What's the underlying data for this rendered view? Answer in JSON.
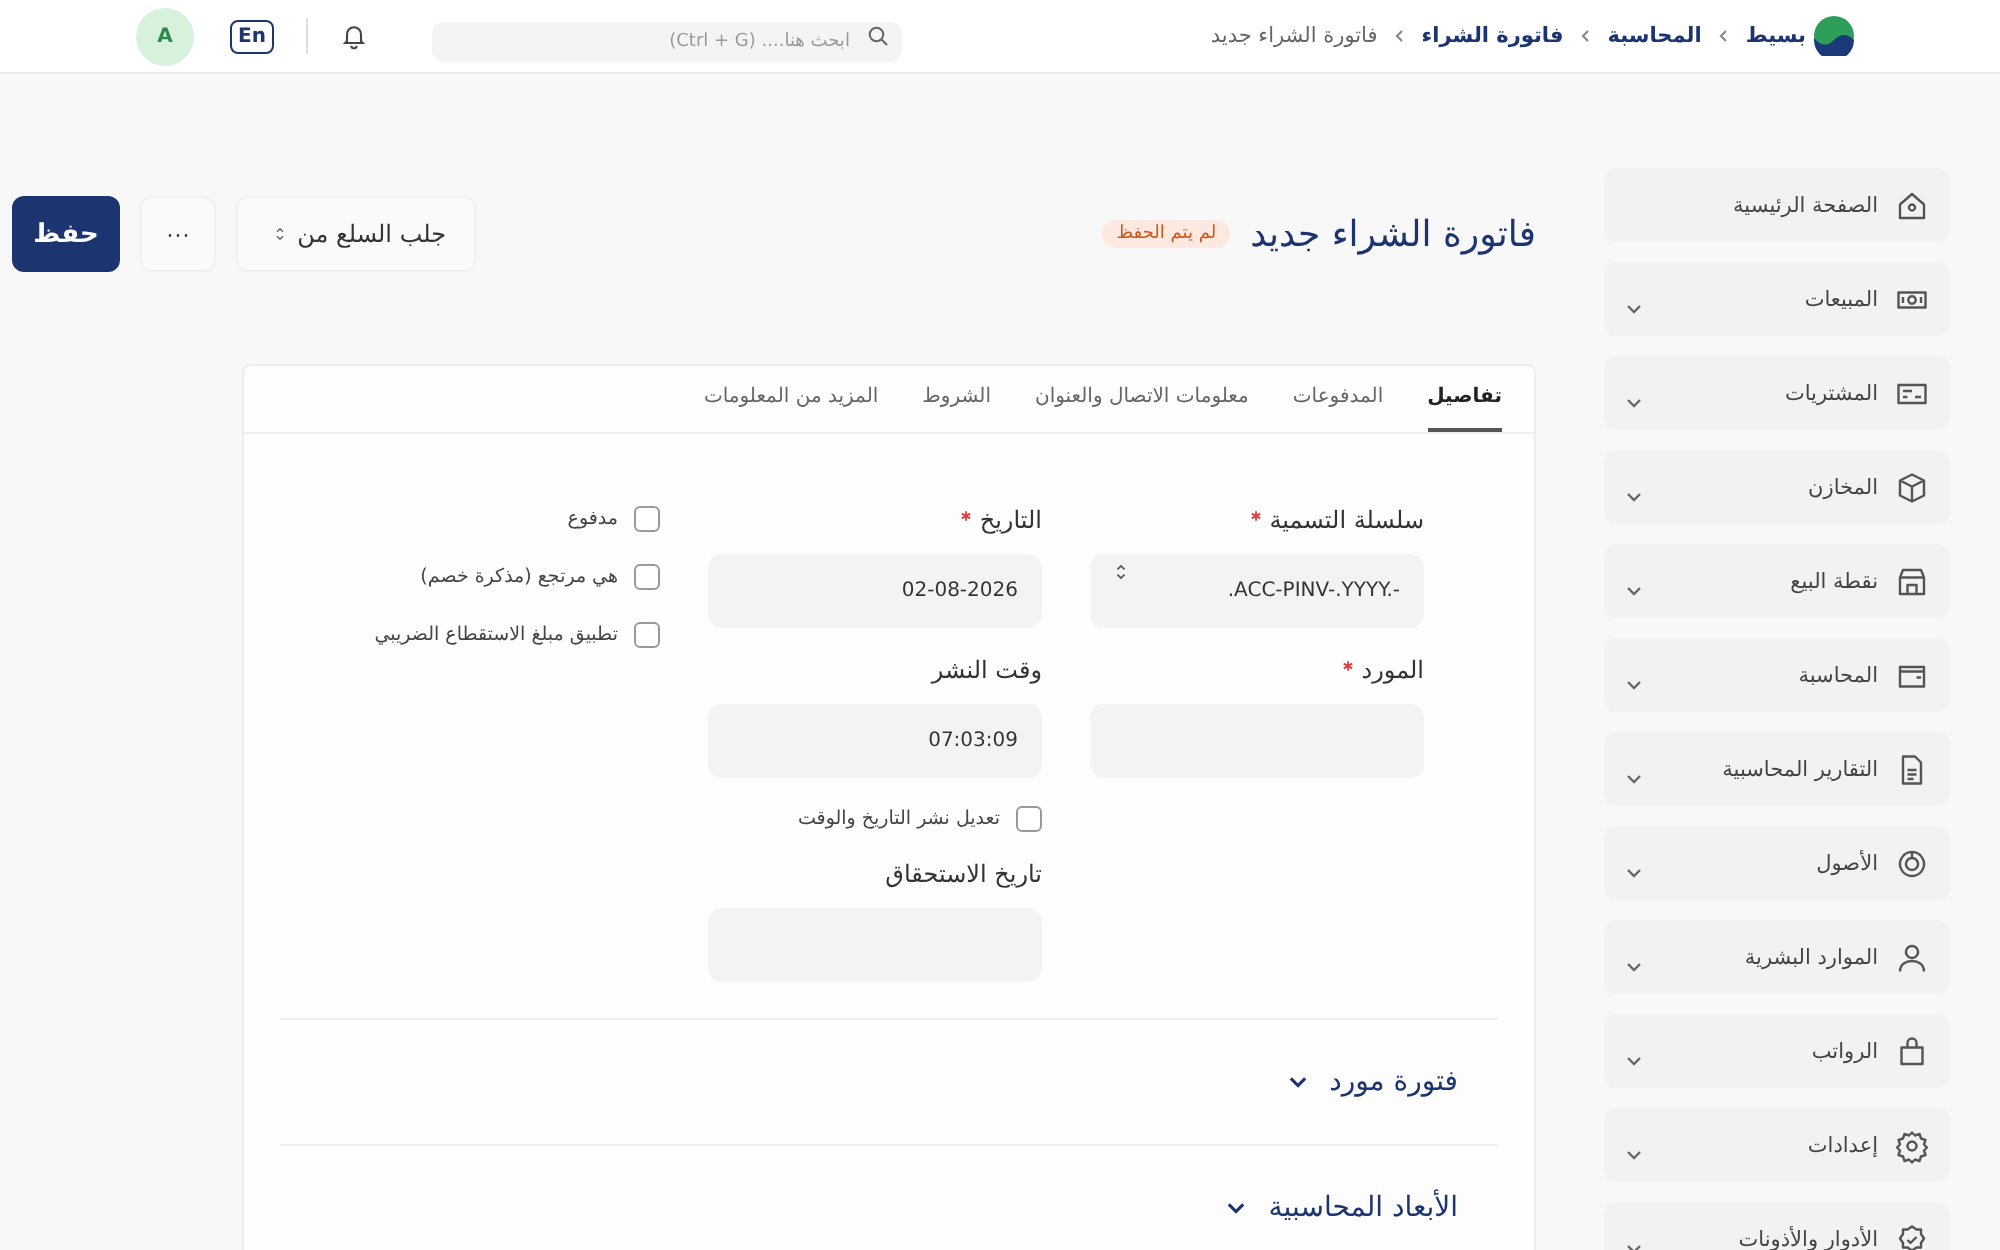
{
  "topbar": {
    "brand": "بسيط",
    "breadcrumbs": [
      "المحاسبة",
      "فاتورة الشراء",
      "فاتورة الشراء جديد"
    ],
    "search": {
      "placeholder": "ابحث هنا.... (Ctrl + G)"
    },
    "language": "En",
    "avatar": "A"
  },
  "sidebar": {
    "items": [
      {
        "label": "الصفحة الرئيسية",
        "kind": "link"
      },
      {
        "label": "المبيعات",
        "kind": "group",
        "expanded": false
      },
      {
        "label": "المشتريات",
        "kind": "group",
        "expanded": false
      },
      {
        "label": "المخازن",
        "kind": "group",
        "expanded": false
      },
      {
        "label": "نقطة البيع",
        "kind": "group",
        "expanded": false
      },
      {
        "label": "المحاسبة",
        "kind": "group",
        "expanded": false
      },
      {
        "label": "التقارير المحاسبية",
        "kind": "group",
        "expanded": false
      },
      {
        "label": "الأصول",
        "kind": "group",
        "expanded": false
      },
      {
        "label": "الموارد البشرية",
        "kind": "group",
        "expanded": false
      },
      {
        "label": "الرواتب",
        "kind": "group",
        "expanded": false
      },
      {
        "label": "إعدادات",
        "kind": "group",
        "expanded": false
      },
      {
        "label": "الأدوار والأذونات",
        "kind": "group",
        "expanded": false
      }
    ]
  },
  "header": {
    "title": "فاتورة الشراء جديد",
    "status": "لم يتم الحفظ",
    "get_items": {
      "placeholder": "جلب السلع من"
    },
    "more": "···",
    "save": "حفظ"
  },
  "tabs": [
    {
      "label": "تفاصيل",
      "selected": true
    },
    {
      "label": "المدفوعات",
      "selected": false
    },
    {
      "label": "معلومات الاتصال والعنوان",
      "selected": false
    },
    {
      "label": "الشروط",
      "selected": false
    },
    {
      "label": "المزيد من المعلومات",
      "selected": false
    }
  ],
  "columns": [
    {
      "items": [
        {
          "kind": "select",
          "label": "سلسلة التسمية",
          "required": true,
          "value": ".ACC-PINV-.YYYY.-"
        },
        {
          "kind": "field",
          "label": "المورد",
          "required": true
        }
      ]
    },
    {
      "items": [
        {
          "kind": "field",
          "label": "التاريخ",
          "required": true,
          "value": "02-08-2026"
        },
        {
          "kind": "field",
          "label": "وقت النشر",
          "required": false,
          "value": "07:03:09"
        },
        {
          "kind": "check",
          "label": "تعديل نشر التاريخ والوقت",
          "checked": false
        },
        {
          "kind": "field",
          "label": "تاريخ الاستحقاق",
          "required": false
        }
      ]
    },
    {
      "items": [
        {
          "kind": "check",
          "label": "مدفوع",
          "checked": false
        },
        {
          "kind": "check",
          "label": "هي مرتجع (مذكرة خصم)",
          "checked": false
        },
        {
          "kind": "check",
          "label": "تطبيق مبلغ الاستقطاع الضريبي",
          "checked": false
        }
      ]
    }
  ],
  "sections": [
    {
      "title": "فتورة مورد",
      "expanded": false
    },
    {
      "title": "الأبعاد المحاسبية",
      "expanded": false
    }
  ]
}
